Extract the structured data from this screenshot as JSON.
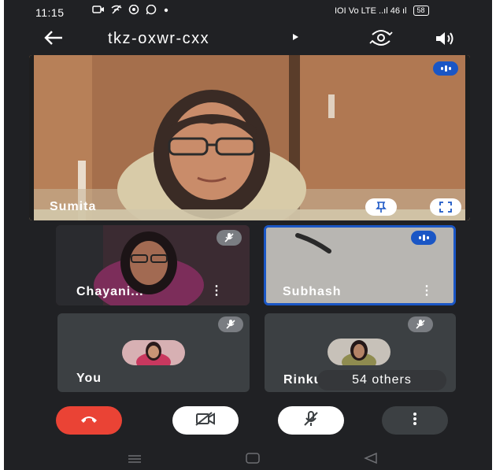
{
  "status_bar": {
    "time": "11:15",
    "left_icons": [
      "camera-icon",
      "wifi-off-icon",
      "chat-icon",
      "whatsapp-icon",
      "dot-icon"
    ],
    "right_text": "IOI Vo LTE ..ıl 46 ıl",
    "battery": "58"
  },
  "app_bar": {
    "back_icon": "arrow-left-icon",
    "meeting_code": "tkz-oxwr-cxx",
    "caret_icon": "triangle-right-icon",
    "switch_camera_icon": "camera-switch-icon",
    "speaker_icon": "speaker-icon"
  },
  "main_tile": {
    "participant": "Sumita",
    "pin_icon": "pin-icon",
    "fullscreen_icon": "fullscreen-icon",
    "speaking_icon": "speaking-indicator-icon"
  },
  "tiles": [
    {
      "participant": "Chayani...",
      "muted": true,
      "more_icon": "more-vert-icon"
    },
    {
      "participant": "Subhash",
      "speaking": true,
      "more_icon": "more-vert-icon"
    },
    {
      "participant": "You",
      "muted": true
    },
    {
      "participant": "Rinku",
      "muted": true
    }
  ],
  "others_chip": "54 others",
  "controls": {
    "end_call_icon": "phone-hangup-icon",
    "camera_icon": "video-off-icon",
    "mic_icon": "mic-off-icon",
    "more_icon": "more-vert-icon"
  },
  "nav_bar": [
    "menu-icon",
    "home-icon",
    "back-triangle-icon"
  ],
  "colors": {
    "background": "#202124",
    "tile": "#3c4043",
    "accent_blue": "#1a56c5",
    "end_call_red": "#ea4335",
    "muted_badge": "#7a7d82"
  }
}
